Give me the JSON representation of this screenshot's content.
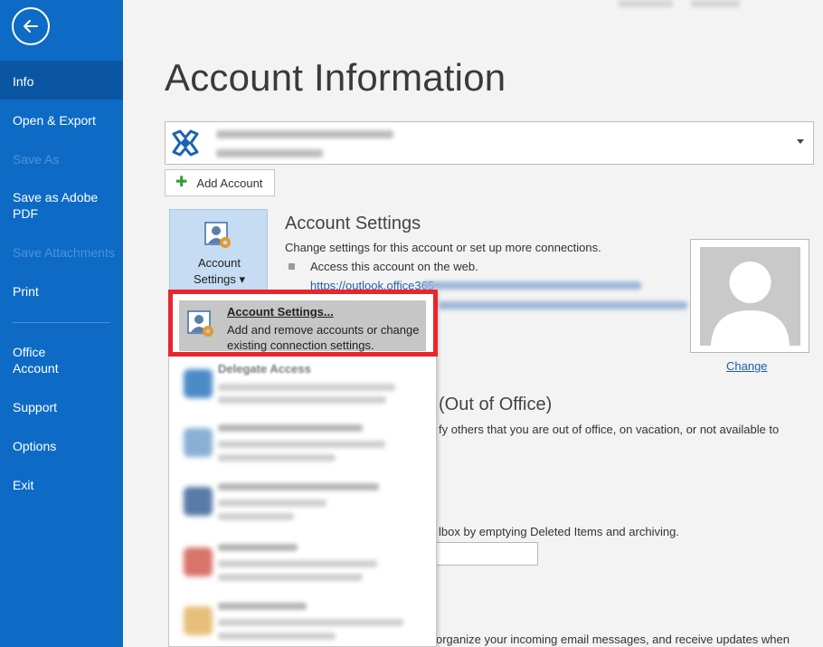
{
  "sidebar": {
    "back_label": "Back",
    "items": [
      {
        "label": "Info"
      },
      {
        "label": "Open & Export"
      },
      {
        "label": "Save As"
      },
      {
        "label": "Save as Adobe PDF"
      },
      {
        "label": "Save Attachments"
      },
      {
        "label": "Print"
      },
      {
        "label": "Office Account"
      },
      {
        "label": "Support"
      },
      {
        "label": "Options"
      },
      {
        "label": "Exit"
      }
    ]
  },
  "main": {
    "title": "Account Information",
    "add_account_label": "Add Account",
    "account_settings_button": {
      "line1": "Account",
      "line2": "Settings ▾"
    },
    "account_settings_section": {
      "title": "Account Settings",
      "description": "Change settings for this account or set up more connections.",
      "bullet": "Access this account on the web.",
      "link": "https://outlook.office365"
    },
    "change_photo_label": "Change",
    "ooo": {
      "title": "(Out of Office)",
      "text": "fy others that you are out of office, on vacation, or not available to"
    },
    "mailbox_text": "lbox by emptying Deleted Items and archiving.",
    "rules_text": "organize your incoming email messages, and receive updates when"
  },
  "dropdown": {
    "highlighted": {
      "title": "Account Settings...",
      "description": "Add and remove accounts or change existing connection settings."
    },
    "delegate_title": "Delegate Access"
  },
  "colors": {
    "sidebar": "#0d6bc6",
    "sidebar_active": "#0a56a3",
    "highlight_border": "#e8262c",
    "link": "#1f5fad"
  }
}
